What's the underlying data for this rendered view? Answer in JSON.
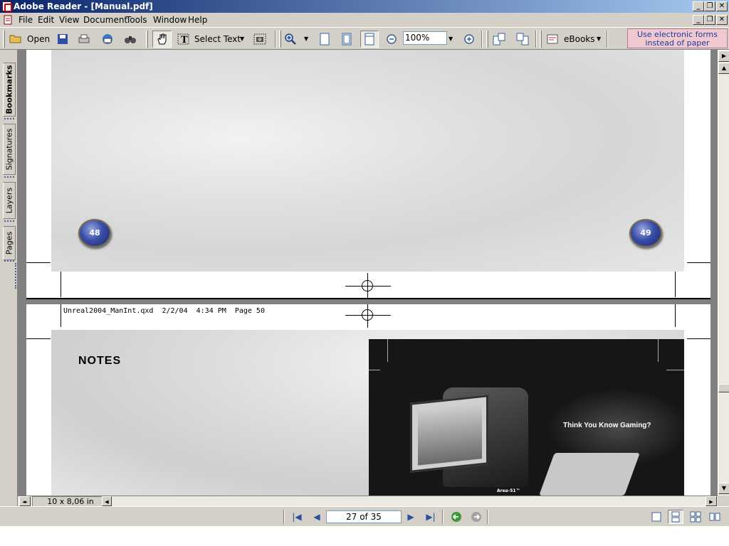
{
  "titlebar": {
    "title": "Adobe Reader - [Manual.pdf]"
  },
  "menu": [
    "File",
    "Edit",
    "View",
    "Document",
    "Tools",
    "Window",
    "Help"
  ],
  "toolbar": {
    "open_label": "Open",
    "select_text_label": "Select Text",
    "zoom_value": "100%",
    "ebooks_label": "eBooks",
    "promo_line1": "Use electronic forms",
    "promo_line2": "instead of paper"
  },
  "navtabs": [
    "Bookmarks",
    "Signatures",
    "Layers",
    "Pages"
  ],
  "page_top": {
    "left_page_num": "48",
    "right_page_num": "49"
  },
  "page_bottom": {
    "slug": "Unreal2004_ManInt.qxd  2/2/04  4:34 PM  Page 50",
    "notes_heading": "NOTES",
    "ad_headline": "Think You Know Gaming?",
    "ad_brand": "Area-51™"
  },
  "status": {
    "page_size": "10 x 8,06 in",
    "page_indicator": "27 of 35"
  },
  "colors": {
    "titlebar_start": "#0a246a",
    "titlebar_end": "#a6caf0",
    "chrome": "#d4d0c8",
    "promo_bg": "#f0c8d0"
  }
}
